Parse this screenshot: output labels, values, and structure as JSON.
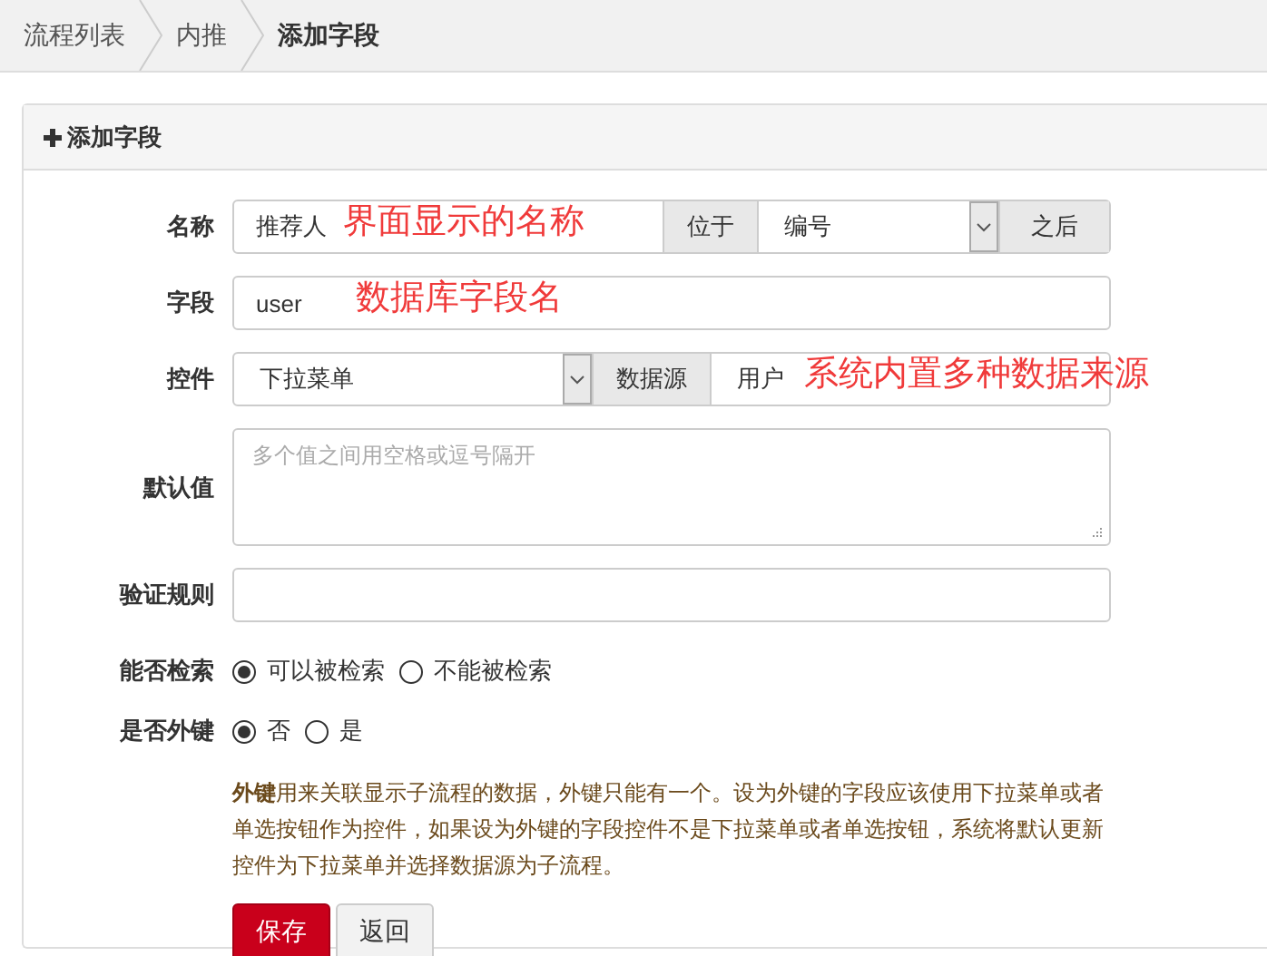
{
  "breadcrumb": [
    {
      "label": "流程列表",
      "current": false
    },
    {
      "label": "内推",
      "current": false
    },
    {
      "label": "添加字段",
      "current": true
    }
  ],
  "panel": {
    "title": "添加字段"
  },
  "name_row": {
    "label": "名称",
    "value": "推荐人",
    "annotation": "界面显示的名称",
    "position_label": "位于",
    "position_value": "编号",
    "after_label": "之后"
  },
  "field_row": {
    "label": "字段",
    "value": "user",
    "annotation": "数据库字段名"
  },
  "control_row": {
    "label": "控件",
    "value": "下拉菜单",
    "source_label": "数据源",
    "source_value": "用户",
    "annotation": "系统内置多种数据来源"
  },
  "default_row": {
    "label": "默认值",
    "placeholder": "多个值之间用空格或逗号隔开"
  },
  "validation_row": {
    "label": "验证规则"
  },
  "searchable": {
    "label": "能否检索",
    "options": [
      {
        "label": "可以被检索",
        "selected": true
      },
      {
        "label": "不能被检索",
        "selected": false
      }
    ]
  },
  "foreign_key": {
    "label": "是否外键",
    "options": [
      {
        "label": "否",
        "selected": true
      },
      {
        "label": "是",
        "selected": false
      }
    ]
  },
  "help_text": "**外键**用来关联显示子流程的数据，外键只能有一个。设为外键的字段应该使用下拉菜单或者单选按钮作为控件，如果设为外键的字段控件不是下拉菜单或者单选按钮，系统将默认更新控件为下拉菜单并选择数据源为子流程。",
  "buttons": [
    {
      "label": "保存",
      "kind": "primary"
    },
    {
      "label": "返回",
      "kind": "default"
    }
  ]
}
